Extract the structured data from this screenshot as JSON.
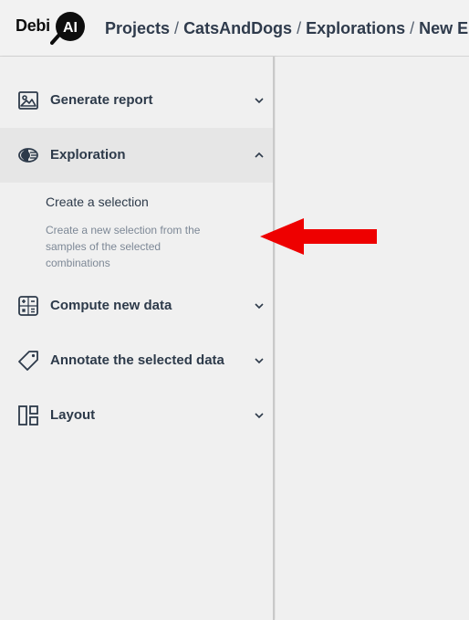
{
  "header": {
    "logo_text": "Debi",
    "logo_badge": "AI",
    "breadcrumb": [
      "Projects",
      "CatsAndDogs",
      "Explorations",
      "New E"
    ]
  },
  "sidebar": {
    "items": [
      {
        "label": "Generate report",
        "icon": "image-icon",
        "expanded": false
      },
      {
        "label": "Exploration",
        "icon": "exploration-icon",
        "expanded": true
      },
      {
        "label": "Compute new data",
        "icon": "calculator-icon",
        "expanded": false
      },
      {
        "label": "Annotate the selected data",
        "icon": "tag-icon",
        "expanded": false
      },
      {
        "label": "Layout",
        "icon": "layout-icon",
        "expanded": false
      }
    ],
    "exploration_sub": {
      "title": "Create a selection",
      "description": "Create a new selection from the samples of the selected combinations"
    }
  },
  "colors": {
    "arrow": "#ee0000",
    "active_bg": "#e6e6e6",
    "text": "#2d3a4a",
    "muted": "#7d8896"
  }
}
